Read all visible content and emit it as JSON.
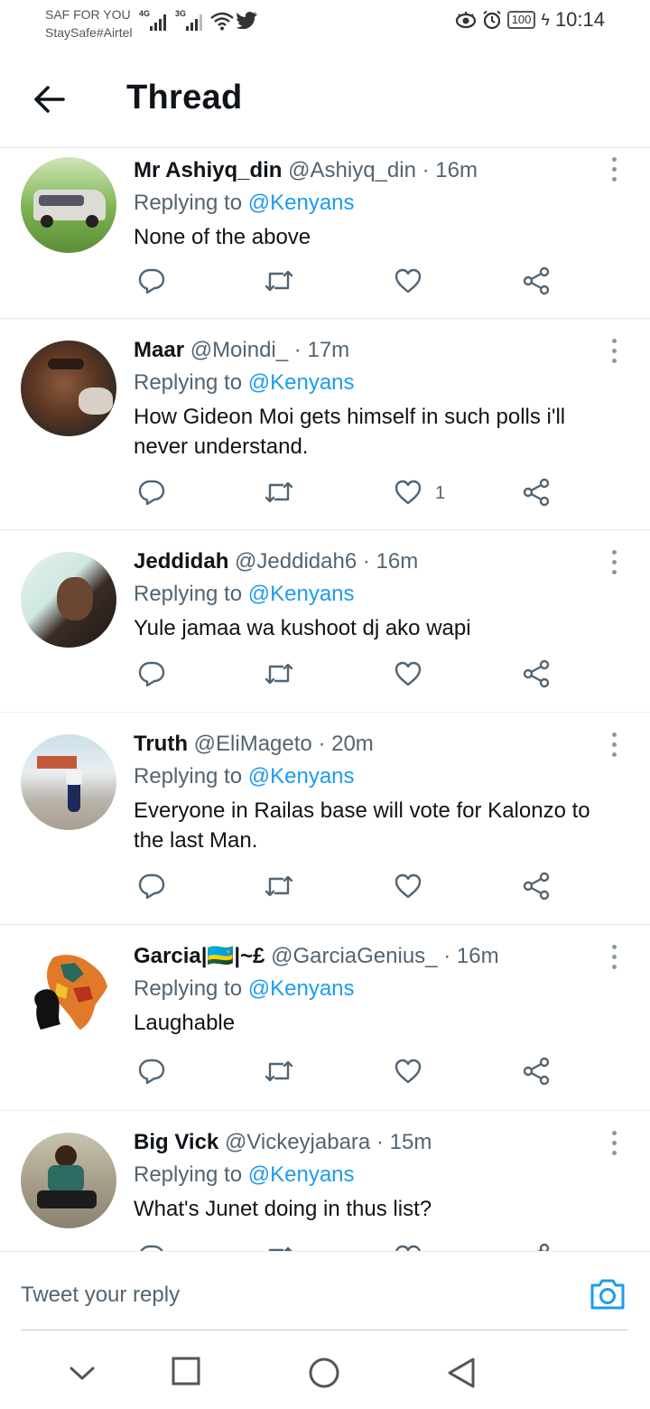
{
  "status_bar": {
    "carrier_line1": "SAF FOR YOU",
    "carrier_line2": "StaySafe#Airtel",
    "network1": "4G",
    "network2": "3G",
    "battery": "100",
    "time": "10:14"
  },
  "header": {
    "title": "Thread"
  },
  "tweets": [
    {
      "name": "Mr Ashiyq_din",
      "handle": "@Ashiyq_din",
      "time": "16m",
      "replying_prefix": "Replying to",
      "replying_to": "@Kenyans",
      "text": "None of the above",
      "likes": ""
    },
    {
      "name": "Maar",
      "handle": "@Moindi_",
      "time": "17m",
      "replying_prefix": "Replying to",
      "replying_to": "@Kenyans",
      "text": "How Gideon Moi gets himself in such polls i'll never understand.",
      "likes": "1"
    },
    {
      "name": "Jeddidah",
      "handle": "@Jeddidah6",
      "time": "16m",
      "replying_prefix": "Replying to",
      "replying_to": "@Kenyans",
      "text": "Yule jamaa wa kushoot dj ako wapi",
      "likes": ""
    },
    {
      "name": "Truth",
      "handle": "@EliMageto",
      "time": "20m",
      "replying_prefix": "Replying to",
      "replying_to": "@Kenyans",
      "text": "Everyone in Railas base will vote for Kalonzo to the last Man.",
      "likes": ""
    },
    {
      "name": "Garcia|🇷🇼|~£",
      "handle": "@GarciaGenius_",
      "time": "16m",
      "replying_prefix": "Replying to",
      "replying_to": "@Kenyans",
      "text": "Laughable",
      "likes": ""
    },
    {
      "name": "Big Vick",
      "handle": "@Vickeyjabara",
      "time": "15m",
      "replying_prefix": "Replying to",
      "replying_to": "@Kenyans",
      "text": "What's Junet doing in thus list?",
      "likes": ""
    }
  ],
  "reply_bar": {
    "placeholder": "Tweet your reply"
  },
  "colors": {
    "link": "#1d9bf0",
    "secondary_text": "#536471",
    "divider": "#e6ecf0"
  },
  "icons": {
    "header": "back-arrow-icon",
    "tweet_actions": [
      "reply-icon",
      "retweet-icon",
      "like-icon",
      "share-icon"
    ],
    "tweet_menu": "more-icon",
    "reply_bar": "camera-icon",
    "nav": [
      "chevron-down-icon",
      "recents-square-icon",
      "home-circle-icon",
      "back-triangle-icon"
    ]
  }
}
